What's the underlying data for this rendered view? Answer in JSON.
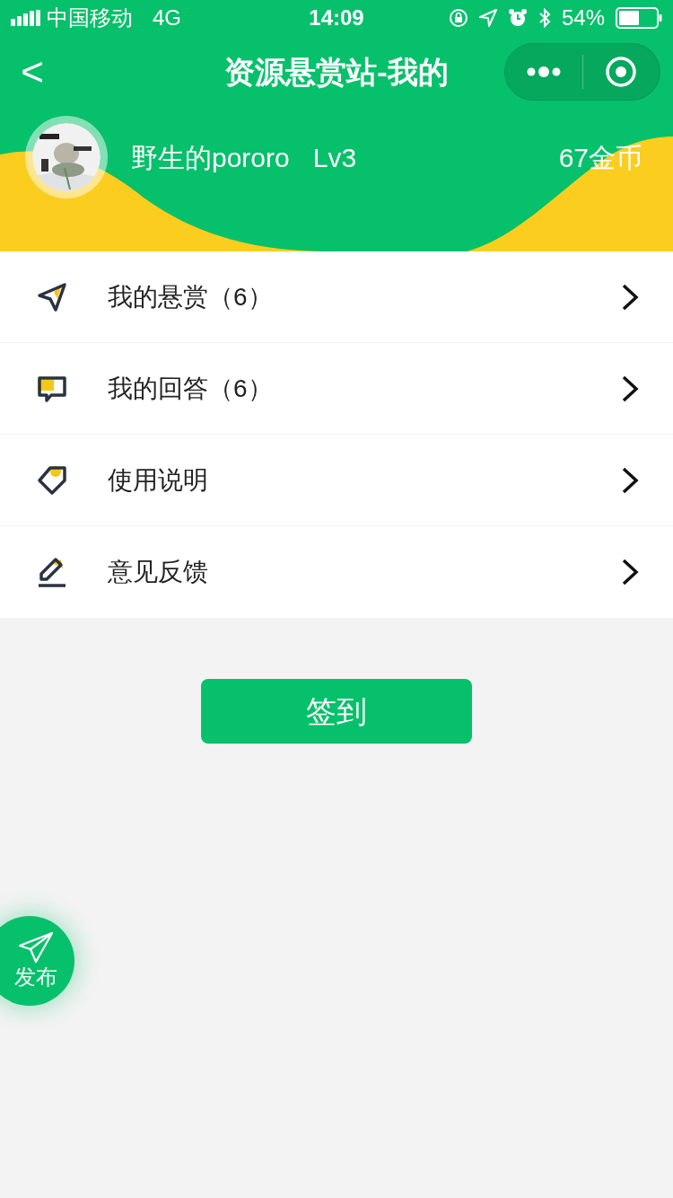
{
  "status_bar": {
    "carrier": "中国移动",
    "network": "4G",
    "time": "14:09",
    "battery": "54%"
  },
  "nav": {
    "back": "<",
    "title": "资源悬赏站-我的"
  },
  "profile": {
    "name": "野生的pororo",
    "level": "Lv3",
    "coins": "67金币"
  },
  "menu": [
    {
      "kind": "send",
      "label": "我的悬赏（6）"
    },
    {
      "kind": "chat",
      "label": "我的回答（6）"
    },
    {
      "kind": "tag",
      "label": "使用说明"
    },
    {
      "kind": "edit",
      "label": "意见反馈"
    }
  ],
  "checkin_button": "签到",
  "fab": {
    "label": "发布"
  }
}
